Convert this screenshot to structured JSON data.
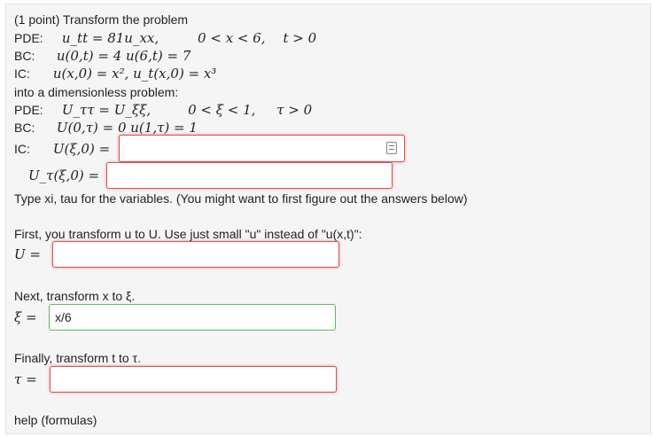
{
  "problem": {
    "title": "(1 point) Transform the problem",
    "pde_label": "PDE:",
    "bc_label": "BC:",
    "ic_label": "IC:",
    "pde": "u_tt = 81u_xx,",
    "pde_domain": "0 < x < 6,",
    "pde_time": "t > 0",
    "bc": "u(0,t) = 4   u(6,t) = 7",
    "ic": "u(x,0) = x², u_t(x,0) = x³",
    "into_text": "into a dimensionless problem:",
    "pde2": "U_ττ = U_ξξ,",
    "pde2_domain": "0 < ξ < 1,",
    "pde2_time": "τ > 0",
    "bc2": "U(0,τ) = 0   u(1,τ) = 1",
    "ic2_label": "U(ξ,0) =",
    "ic2t_label": "U_τ(ξ,0) =",
    "type_note": "Type xi, tau for the variables. (You might want to first figure out the answers below)"
  },
  "steps": {
    "step1_text": "First, you transform u to U. Use just small \"u\" instead of \"u(x,t)\":",
    "step1_lhs": "U =",
    "step2_text": "Next, transform x to ξ.",
    "step2_lhs": "ξ =",
    "step2_value": "x/6",
    "step3_text": "Finally, transform t to τ.",
    "step3_lhs": "τ =",
    "help_link": "help (formulas)"
  }
}
